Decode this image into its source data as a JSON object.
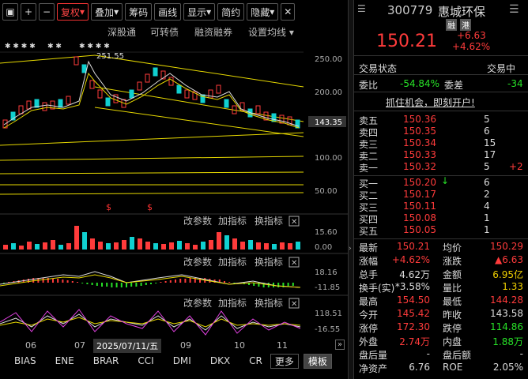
{
  "toolbar": {
    "items": [
      "+",
      "−",
      "复权",
      "叠加",
      "筹码",
      "画线",
      "显示",
      "简约",
      "隐藏"
    ]
  },
  "subbar": {
    "items": [
      "深股通",
      "可转债",
      "融资融券",
      "设置均线"
    ]
  },
  "chart": {
    "price_labels": [
      "250.00",
      "200.00",
      "143.35",
      "100.00",
      "50.00"
    ],
    "peak_label": "251.55",
    "vol_labels": [
      "15.60",
      "0.00"
    ],
    "macd_labels": [
      "18.16",
      "-11.85"
    ],
    "kdj_labels": [
      "118.51",
      "-16.55"
    ],
    "panel_buttons": [
      "改参数",
      "加指标",
      "换指标"
    ],
    "s_marks": [
      "$",
      "$"
    ]
  },
  "timebar": {
    "labels": [
      "06",
      "07",
      "2025/07/11/五",
      "09",
      "10",
      "11"
    ]
  },
  "tabs": {
    "items": [
      "BIAS",
      "ENE",
      "BRAR",
      "CCI",
      "DMI",
      "DKX",
      "CR",
      "更多",
      "模板"
    ]
  },
  "quote": {
    "code": "300779",
    "name": "惠城环保",
    "tags": [
      "融",
      "港"
    ],
    "price": "150.21",
    "change": "+6.63",
    "change_pct": "+4.62%",
    "status_label": "交易状态",
    "status_value": "交易中",
    "weibi_label": "委比",
    "weibi_value": "-54.84%",
    "weicha_label": "委差",
    "weicha_value": "-34",
    "promo": "抓住机会，即刻开户!"
  },
  "asks": [
    {
      "label": "卖五",
      "price": "150.36",
      "vol": "5",
      "chg": ""
    },
    {
      "label": "卖四",
      "price": "150.35",
      "vol": "6",
      "chg": ""
    },
    {
      "label": "卖三",
      "price": "150.34",
      "vol": "15",
      "chg": ""
    },
    {
      "label": "卖二",
      "price": "150.33",
      "vol": "17",
      "chg": ""
    },
    {
      "label": "卖一",
      "price": "150.32",
      "vol": "5",
      "chg": "+2"
    }
  ],
  "bids": [
    {
      "label": "买一",
      "price": "150.20",
      "vol": "6",
      "chg": ""
    },
    {
      "label": "买二",
      "price": "150.17",
      "vol": "2",
      "chg": ""
    },
    {
      "label": "买三",
      "price": "150.11",
      "vol": "4",
      "chg": ""
    },
    {
      "label": "买四",
      "price": "150.08",
      "vol": "1",
      "chg": ""
    },
    {
      "label": "买五",
      "price": "150.05",
      "vol": "1",
      "chg": ""
    }
  ],
  "stats": [
    {
      "l1": "最新",
      "v1": "150.21",
      "c1": "red",
      "l2": "均价",
      "v2": "150.29",
      "c2": "red"
    },
    {
      "l1": "涨幅",
      "v1": "+4.62%",
      "c1": "red",
      "l2": "涨跌",
      "v2": "▲6.63",
      "c2": "red"
    },
    {
      "l1": "总手",
      "v1": "4.62万",
      "c1": "white",
      "l2": "金额",
      "v2": "6.95亿",
      "c2": "yellow"
    },
    {
      "l1": "换手(实)",
      "v1": "*3.58%",
      "c1": "white",
      "l2": "量比",
      "v2": "1.33",
      "c2": "yellow"
    },
    {
      "l1": "最高",
      "v1": "154.50",
      "c1": "red",
      "l2": "最低",
      "v2": "144.28",
      "c2": "red"
    },
    {
      "l1": "今开",
      "v1": "145.42",
      "c1": "red",
      "l2": "昨收",
      "v2": "143.58",
      "c2": "white"
    },
    {
      "l1": "涨停",
      "v1": "172.30",
      "c1": "red",
      "l2": "跌停",
      "v2": "114.86",
      "c2": "green"
    },
    {
      "l1": "外盘",
      "v1": "2.74万",
      "c1": "red",
      "l2": "内盘",
      "v2": "1.88万",
      "c2": "green"
    },
    {
      "l1": "盘后量",
      "v1": "-",
      "c1": "white",
      "l2": "盘后额",
      "v2": "-",
      "c2": "white"
    },
    {
      "l1": "净资产",
      "v1": "6.76",
      "c1": "white",
      "l2": "ROE",
      "v2": "2.05%",
      "c2": "white"
    }
  ]
}
